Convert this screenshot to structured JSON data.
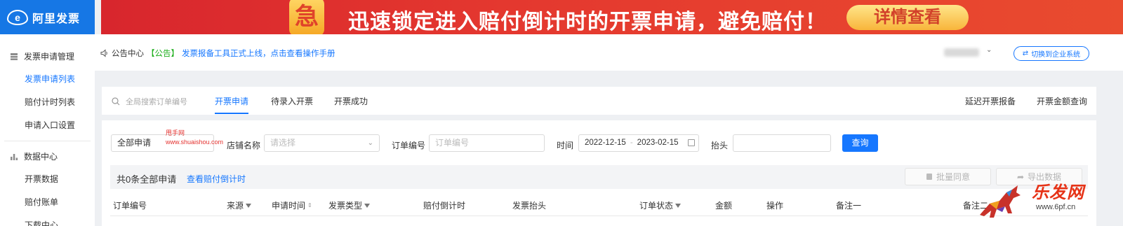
{
  "logo": {
    "mark": "e",
    "name": "阿里发票"
  },
  "banner": {
    "badge": "急",
    "message": "迅速锁定进入赔付倒计时的开票申请，避免赔付！",
    "button": "详情查看"
  },
  "sidebar": {
    "groups": [
      {
        "label": "发票申请管理",
        "icon": "list-icon",
        "items": [
          "发票申请列表",
          "赔付计时列表",
          "申请入口设置"
        ]
      },
      {
        "label": "数据中心",
        "icon": "bar-chart-icon",
        "items": [
          "开票数据",
          "赔付账单",
          "下载中心"
        ]
      }
    ],
    "active_item": "发票申请列表"
  },
  "notice": {
    "center_label": "公告中心",
    "tag": "【公告】",
    "text": "发票报备工具正式上线，点击查看操作手册"
  },
  "header": {
    "switch_button": "切换到企业系统"
  },
  "search": {
    "placeholder": "全局搜索订单编号"
  },
  "tabs": {
    "items": [
      "开票申请",
      "待录入开票",
      "开票成功"
    ],
    "active": "开票申请",
    "right_links": [
      "延迟开票报备",
      "开票金额查询"
    ]
  },
  "filters": {
    "type_select": "全部申请",
    "shop_label": "店铺名称",
    "shop_placeholder": "请选择",
    "order_label": "订单编号",
    "order_placeholder": "订单编号",
    "time_label": "时间",
    "date_start": "2022-12-15",
    "date_end": "2023-02-15",
    "date_sep": "-",
    "title_label": "抬头",
    "query_button": "查询"
  },
  "watermark": {
    "line1": "甩手网",
    "line2": "www.shuaishou.com"
  },
  "summary": {
    "total": "共0条全部申请",
    "link": "查看赔付倒计时",
    "batch_agree": "批量同意",
    "export": "导出数据"
  },
  "table": {
    "columns": [
      "订单编号",
      "来源",
      "申请时间",
      "发票类型",
      "赔付倒计时",
      "发票抬头",
      "订单状态",
      "金额",
      "操作",
      "备注一",
      "备注二"
    ]
  },
  "corner": {
    "brand": "乐发网",
    "url": "www.6pf.cn"
  }
}
